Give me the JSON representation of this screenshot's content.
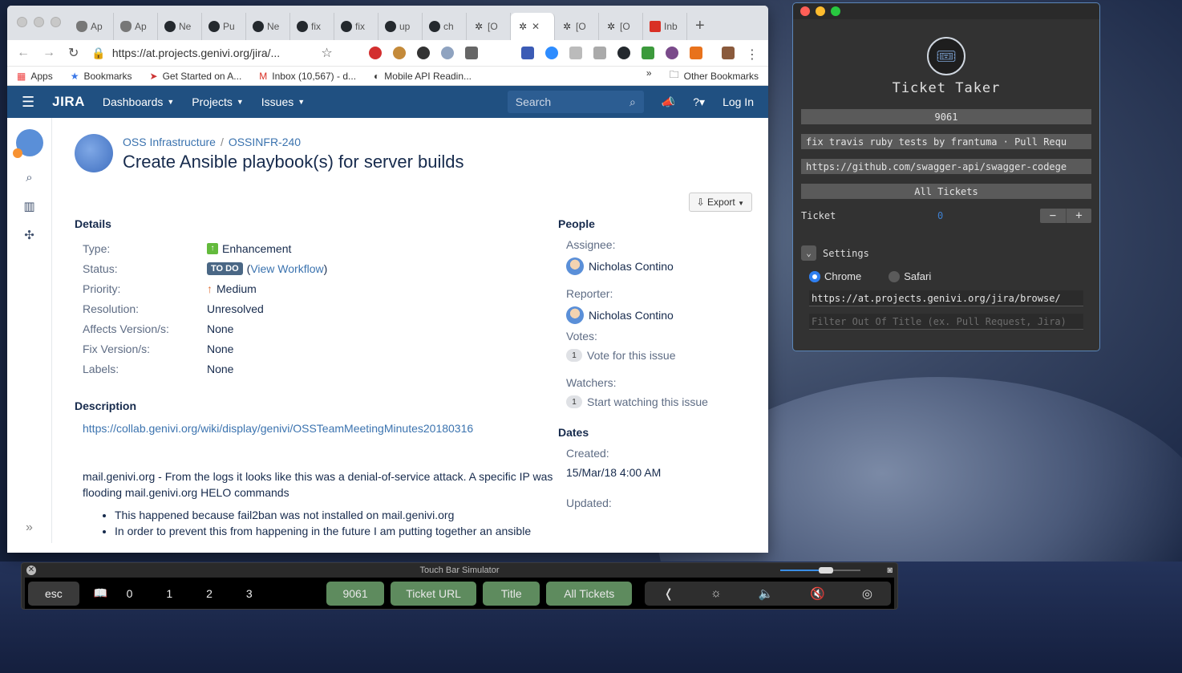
{
  "browser": {
    "tabs": [
      {
        "label": "Ap",
        "icon": "apple-icon"
      },
      {
        "label": "Ap",
        "icon": "apple-icon"
      },
      {
        "label": "Ne",
        "icon": "github-icon"
      },
      {
        "label": "Pu",
        "icon": "github-icon"
      },
      {
        "label": "Ne",
        "icon": "github-icon"
      },
      {
        "label": "fix",
        "icon": "github-icon"
      },
      {
        "label": "fix",
        "icon": "github-icon"
      },
      {
        "label": "up",
        "icon": "github-icon"
      },
      {
        "label": "ch",
        "icon": "github-icon"
      },
      {
        "label": "[O",
        "icon": "jira-icon"
      },
      {
        "label": "✕",
        "icon": "jira-icon"
      },
      {
        "label": "[O",
        "icon": "jira-icon"
      },
      {
        "label": "[O",
        "icon": "jira-icon"
      },
      {
        "label": "Inb",
        "icon": "gmail-icon"
      }
    ],
    "url": "https://at.projects.genivi.org/jira/...",
    "bookmarks": {
      "apps": "Apps",
      "bookmarks": "Bookmarks",
      "getting_started": "Get Started on A...",
      "inbox": "Inbox (10,567) - d...",
      "mobile_api": "Mobile API Readin...",
      "more": "»",
      "other": "Other Bookmarks"
    }
  },
  "jira": {
    "logo": "JIRA",
    "nav": {
      "dashboards": "Dashboards",
      "projects": "Projects",
      "issues": "Issues"
    },
    "search_placeholder": "Search",
    "login": "Log In",
    "breadcrumb": {
      "project": "OSS Infrastructure",
      "issue_key": "OSSINFR-240"
    },
    "title": "Create Ansible playbook(s) for server builds",
    "export": "Export",
    "details": {
      "heading": "Details",
      "type_label": "Type:",
      "type_value": "Enhancement",
      "status_label": "Status:",
      "status_value": "TO DO",
      "workflow_link": "View Workflow",
      "priority_label": "Priority:",
      "priority_value": "Medium",
      "resolution_label": "Resolution:",
      "resolution_value": "Unresolved",
      "affects_label": "Affects Version/s:",
      "affects_value": "None",
      "fix_label": "Fix Version/s:",
      "fix_value": "None",
      "labels_label": "Labels:",
      "labels_value": "None"
    },
    "description": {
      "heading": "Description",
      "link": "https://collab.genivi.org/wiki/display/genivi/OSSTeamMeetingMinutes20180316",
      "paragraph": "mail.genivi.org - From the logs it looks like this was a denial-of-service attack. A specific IP was flooding mail.genivi.org HELO commands",
      "bullets": [
        "This happened because fail2ban was not installed on mail.genivi.org",
        "In order to prevent this from happening in the future I am putting together an ansible"
      ]
    },
    "people": {
      "heading": "People",
      "assignee_label": "Assignee:",
      "assignee": "Nicholas Contino",
      "reporter_label": "Reporter:",
      "reporter": "Nicholas Contino",
      "votes_label": "Votes:",
      "votes_count": "1",
      "vote_link": "Vote for this issue",
      "watchers_label": "Watchers:",
      "watchers_count": "1",
      "watch_link": "Start watching this issue"
    },
    "dates": {
      "heading": "Dates",
      "created_label": "Created:",
      "created": "15/Mar/18 4:00 AM",
      "updated_label": "Updated:"
    }
  },
  "ticket_taker": {
    "title": "Ticket Taker",
    "number": "9061",
    "page_title": "fix travis ruby tests by frantuma · Pull Requ",
    "url": "https://github.com/swagger-api/swagger-codege",
    "all_tickets": "All Tickets",
    "ticket_label": "Ticket",
    "ticket_value": "0",
    "stepper_minus": "−",
    "stepper_plus": "+",
    "settings": "Settings",
    "browser_chrome": "Chrome",
    "browser_safari": "Safari",
    "base_url": "https://at.projects.genivi.org/jira/browse/",
    "filter_placeholder": "Filter Out Of Title (ex. Pull Request, Jira)"
  },
  "touchbar": {
    "title": "Touch Bar Simulator",
    "esc": "esc",
    "numbers": [
      "0",
      "1",
      "2",
      "3"
    ],
    "buttons": [
      "9061",
      "Ticket URL",
      "Title",
      "All Tickets"
    ],
    "controls": [
      "❬",
      "☼",
      "🔈",
      "🔇",
      "◎"
    ]
  }
}
